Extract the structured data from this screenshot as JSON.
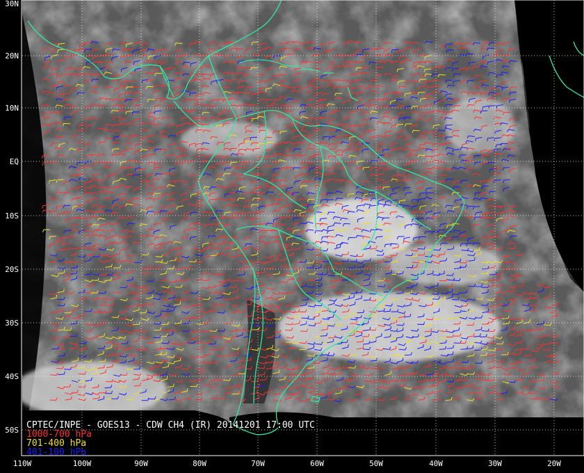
{
  "map": {
    "title": "CPTEC/INPE - GOES13 - CDW CH4 (IR) 20141201 17:00 UTC",
    "lat_labels": [
      "30N",
      "20N",
      "10N",
      "EQ",
      "10S",
      "20S",
      "30S",
      "40S",
      "50S"
    ],
    "lon_labels": [
      "110W",
      "100W",
      "90W",
      "80W",
      "70W",
      "60W",
      "50W",
      "40W",
      "30W",
      "20W"
    ],
    "legend": [
      {
        "label": "1000-700 hPa",
        "color": "#ff3030"
      },
      {
        "label": "701-400 hPa",
        "color": "#f0e020"
      },
      {
        "label": "401-100 hPa",
        "color": "#1a1aff"
      }
    ],
    "colors": {
      "coastline": "#30e8a0",
      "grid": "#ffffff",
      "background": "#000000"
    }
  }
}
